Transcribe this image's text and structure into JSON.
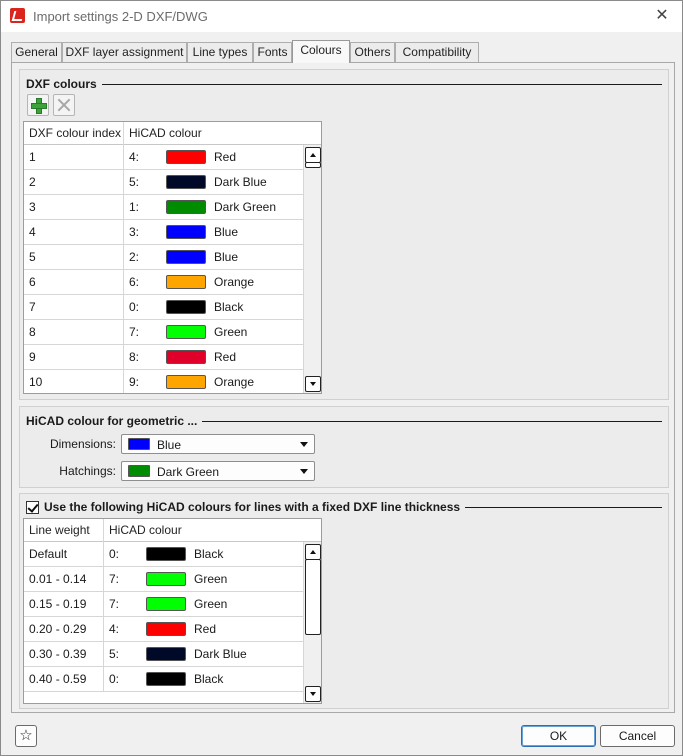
{
  "window": {
    "title": "Import settings 2-D DXF/DWG",
    "close": "✕"
  },
  "tabs": [
    {
      "label": "General"
    },
    {
      "label": "DXF layer assignment"
    },
    {
      "label": "Line types"
    },
    {
      "label": "Fonts"
    },
    {
      "label": "Colours",
      "active": true
    },
    {
      "label": "Others"
    },
    {
      "label": "Compatibility"
    }
  ],
  "dxf_colours": {
    "title": "DXF colours",
    "toolbar": {
      "add_icon": "plus-icon",
      "delete_icon": "delete-icon"
    },
    "columns": [
      "DXF colour index",
      "HiCAD colour"
    ],
    "rows": [
      {
        "index": "1",
        "code": "4:",
        "color": "#ff0000",
        "name": "Red"
      },
      {
        "index": "2",
        "code": "5:",
        "color": "#000a28",
        "name": "Dark Blue"
      },
      {
        "index": "3",
        "code": "1:",
        "color": "#008c00",
        "name": "Dark Green"
      },
      {
        "index": "4",
        "code": "3:",
        "color": "#0000ff",
        "name": "Blue"
      },
      {
        "index": "5",
        "code": "2:",
        "color": "#0000ff",
        "name": "Blue"
      },
      {
        "index": "6",
        "code": "6:",
        "color": "#ffa500",
        "name": "Orange"
      },
      {
        "index": "7",
        "code": "0:",
        "color": "#000000",
        "name": "Black"
      },
      {
        "index": "8",
        "code": "7:",
        "color": "#00ff00",
        "name": "Green"
      },
      {
        "index": "9",
        "code": "8:",
        "color": "#e0002a",
        "name": "Red"
      },
      {
        "index": "10",
        "code": "9:",
        "color": "#ffa500",
        "name": "Orange"
      }
    ]
  },
  "geometric": {
    "title": "HiCAD colour for geometric ...",
    "dimensions": {
      "label": "Dimensions:",
      "value": "Blue",
      "color": "#0000ff"
    },
    "hatchings": {
      "label": "Hatchings:",
      "value": "Dark Green",
      "color": "#008c00"
    }
  },
  "line_thickness": {
    "checkbox_label": "Use the following HiCAD colours for lines with a fixed DXF line thickness",
    "checked": true,
    "columns": [
      "Line weight",
      "HiCAD colour"
    ],
    "rows": [
      {
        "weight": "Default",
        "code": "0:",
        "color": "#000000",
        "name": "Black"
      },
      {
        "weight": "0.01 - 0.14",
        "code": "7:",
        "color": "#00ff00",
        "name": "Green"
      },
      {
        "weight": "0.15 - 0.19",
        "code": "7:",
        "color": "#00ff00",
        "name": "Green"
      },
      {
        "weight": "0.20 - 0.29",
        "code": "4:",
        "color": "#ff0000",
        "name": "Red"
      },
      {
        "weight": "0.30 - 0.39",
        "code": "5:",
        "color": "#000a28",
        "name": "Dark Blue"
      },
      {
        "weight": "0.40 - 0.59",
        "code": "0:",
        "color": "#000000",
        "name": "Black"
      }
    ]
  },
  "footer": {
    "ok": "OK",
    "cancel": "Cancel",
    "favorite_icon": "star-icon"
  }
}
